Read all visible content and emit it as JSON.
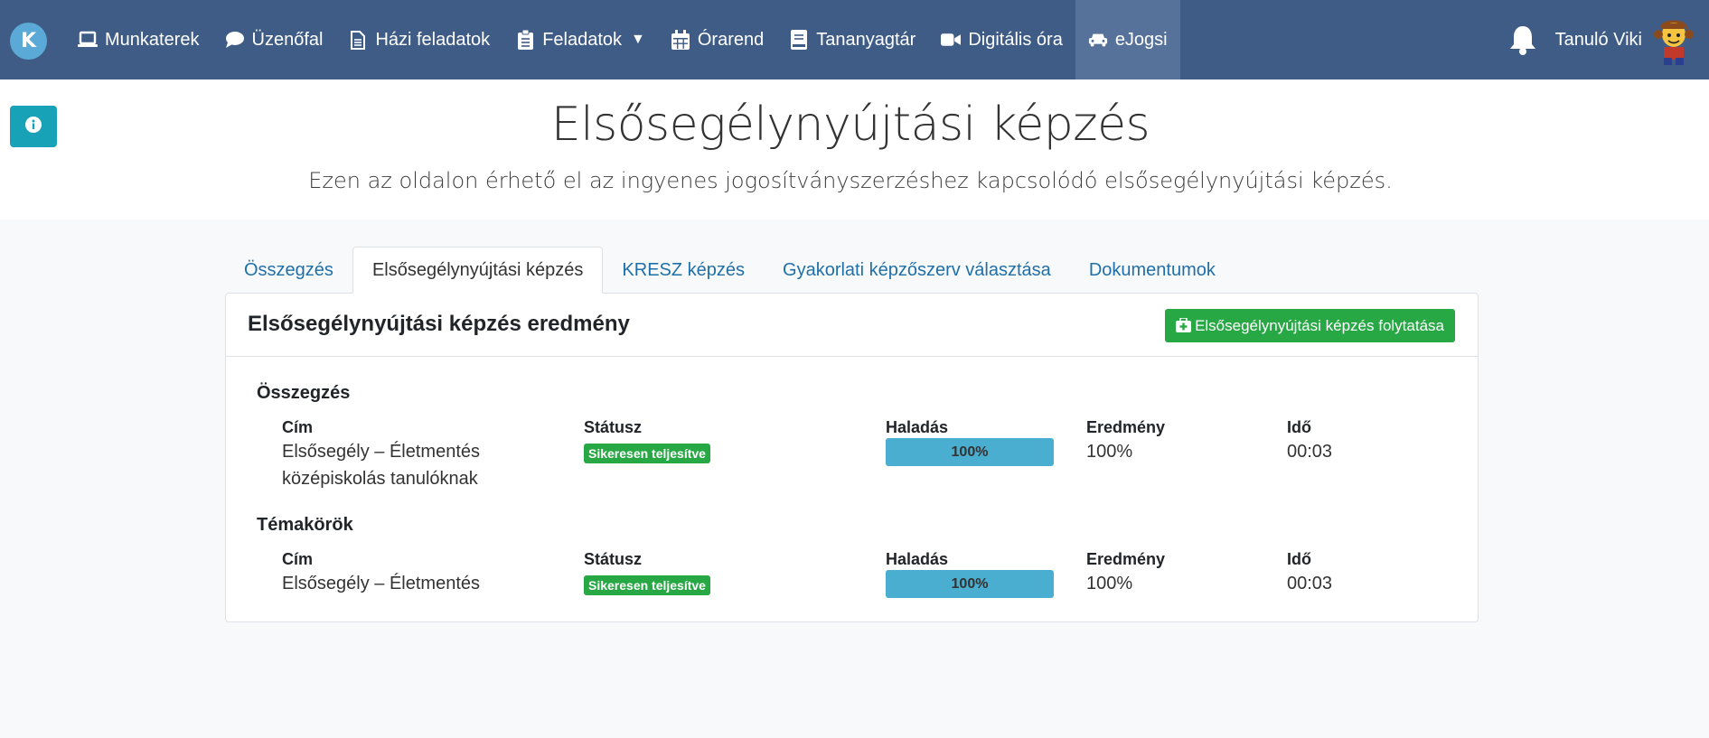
{
  "navbar": {
    "brand_letter": "K",
    "items": [
      {
        "label": "Munkaterek",
        "icon": "laptop-icon"
      },
      {
        "label": "Üzenőfal",
        "icon": "comment-icon"
      },
      {
        "label": "Házi feladatok",
        "icon": "file-icon"
      },
      {
        "label": "Feladatok",
        "icon": "clipboard-icon",
        "caret": "▼"
      },
      {
        "label": "Órarend",
        "icon": "calendar-icon"
      },
      {
        "label": "Tananyagtár",
        "icon": "book-icon"
      },
      {
        "label": "Digitális óra",
        "icon": "video-icon"
      },
      {
        "label": "eJogsi",
        "icon": "car-icon",
        "active": true
      }
    ],
    "user_name": "Tanuló Viki"
  },
  "header": {
    "title": "Elsősegélynyújtási képzés",
    "subtitle": "Ezen az oldalon érhető el az ingyenes jogosítványszerzéshez kapcsolódó elsősegélynyújtási képzés."
  },
  "tabs": [
    {
      "label": "Összegzés",
      "active": false
    },
    {
      "label": "Elsősegélynyújtási képzés",
      "active": true
    },
    {
      "label": "KRESZ képzés",
      "active": false
    },
    {
      "label": "Gyakorlati képzőszerv választása",
      "active": false
    },
    {
      "label": "Dokumentumok",
      "active": false
    }
  ],
  "card": {
    "title": "Elsősegélynyújtási képzés eredmény",
    "continue_label": "Elsősegélynyújtási képzés folytatása",
    "columns": {
      "title": "Cím",
      "status": "Státusz",
      "progress": "Haladás",
      "result": "Eredmény",
      "time": "Idő"
    },
    "summary": {
      "heading": "Összegzés",
      "row": {
        "title_line1": "Elsősegély – Életmentés",
        "title_line2": "középiskolás tanulóknak",
        "status": "Sikeresen teljesítve",
        "progress_label": "100%",
        "progress_value": 100,
        "result": "100%",
        "time": "00:03"
      }
    },
    "topics": {
      "heading": "Témakörök",
      "row": {
        "title": "Elsősegély – Életmentés",
        "status": "Sikeresen teljesítve",
        "progress_label": "100%",
        "progress_value": 100,
        "result": "100%",
        "time": "00:03"
      }
    }
  },
  "colors": {
    "navbar": "#3f5c86",
    "navbar_active": "#56729a",
    "info_button": "#17a2b8",
    "success": "#28a745",
    "progress": "#4aaed0",
    "tab_link": "#1f6fa8"
  }
}
